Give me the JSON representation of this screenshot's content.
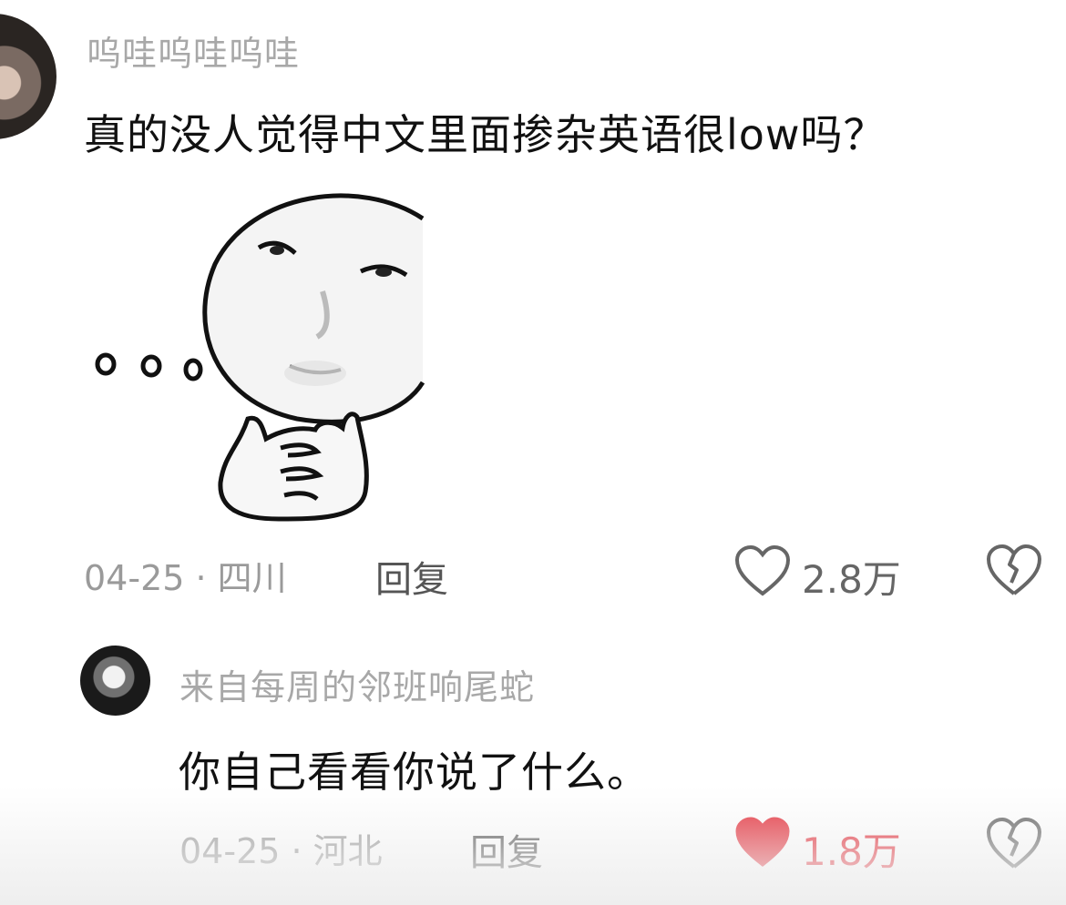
{
  "top_comment": {
    "username": "呜哇呜哇呜哇",
    "text": "真的没人觉得中文里面掺杂英语很low吗？",
    "meta": "04-25 · 四川",
    "reply_label": "回复",
    "like_count": "2.8万",
    "liked": false,
    "sticker_icon": "thinking-face-meme"
  },
  "reply_comment": {
    "username": "来自每周的邻班响尾蛇",
    "text": "你自己看看你说了什么。",
    "meta": "04-25 · 河北",
    "reply_label": "回复",
    "like_count": "1.8万",
    "liked": true
  },
  "colors": {
    "like_active": "#e5323d",
    "text_secondary": "#9a9a9a",
    "icon_gray": "#666666"
  }
}
